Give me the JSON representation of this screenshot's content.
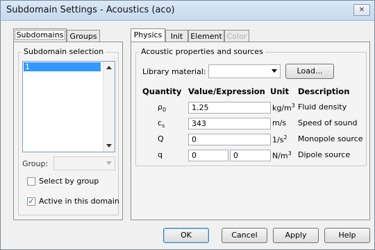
{
  "window": {
    "title": "Subdomain Settings - Acoustics (aco)",
    "close_glyph": "✕"
  },
  "left_tabs": [
    {
      "label": "Subdomains"
    },
    {
      "label": "Groups"
    }
  ],
  "left_panel": {
    "selection_label": "Subdomain selection",
    "items": [
      "1"
    ],
    "group_label": "Group:",
    "group_value": "",
    "select_by_group": {
      "label": "Select by group",
      "checked": false
    },
    "active_in_domain": {
      "label": "Active in this domain",
      "checked": true,
      "check_glyph": "✓"
    }
  },
  "right_tabs": [
    {
      "label": "Physics"
    },
    {
      "label": "Init"
    },
    {
      "label": "Element"
    },
    {
      "label": "Color"
    }
  ],
  "acoustic": {
    "group_label": "Acoustic properties and sources",
    "library_label": "Library material:",
    "library_value": "",
    "load_button": "Load...",
    "headers": {
      "quantity": "Quantity",
      "value": "Value/Expression",
      "unit": "Unit",
      "description": "Description"
    },
    "rows": [
      {
        "sym": "ρ",
        "sub": "0",
        "value": "1.25",
        "unit": "kg/m",
        "unit_sup": "3",
        "desc": "Fluid density"
      },
      {
        "sym": "c",
        "sub": "s",
        "value": "343",
        "unit": "m/s",
        "unit_sup": "",
        "desc": "Speed of sound"
      },
      {
        "sym": "Q",
        "sub": "",
        "value": "0",
        "unit": "1/s",
        "unit_sup": "2",
        "desc": "Monopole source"
      },
      {
        "sym": "q",
        "sub": "",
        "value": "0",
        "value2": "0",
        "unit": "N/m",
        "unit_sup": "3",
        "desc": "Dipole source"
      }
    ]
  },
  "buttons": {
    "ok": "OK",
    "cancel": "Cancel",
    "apply": "Apply",
    "help": "Help"
  }
}
